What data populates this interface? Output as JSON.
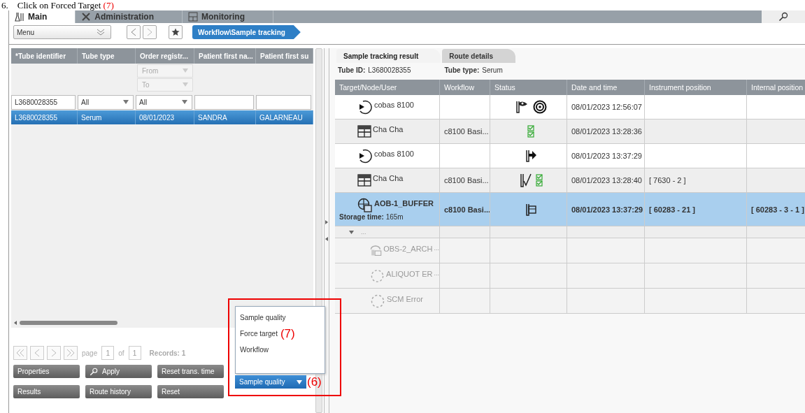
{
  "caption": {
    "number": "6.",
    "text": "Click on Forced Target",
    "marker": "(7)"
  },
  "top_tabs": [
    {
      "label": "Main",
      "selected": true
    },
    {
      "label": "Administration",
      "selected": false
    },
    {
      "label": "Monitoring",
      "selected": false
    }
  ],
  "toolbar": {
    "menu": "Menu",
    "breadcrumb": "Workflow\\Sample tracking"
  },
  "search_table": {
    "columns": [
      "*Tube identifier",
      "Tube type",
      "Order registr...",
      "Patient first na...",
      "Patient first su"
    ],
    "date_filters": {
      "from": "From",
      "to": "To"
    },
    "filters": [
      {
        "kind": "text",
        "value": "L3680028355"
      },
      {
        "kind": "select",
        "value": "All"
      },
      {
        "kind": "select",
        "value": "All"
      },
      {
        "kind": "text"
      },
      {
        "kind": "text"
      }
    ],
    "rows": [
      {
        "cells": [
          "L3680028355",
          "Serum",
          "08/01/2023",
          "SANDRA",
          "GALARNEAU"
        ],
        "selected": true
      }
    ]
  },
  "pager": {
    "page_label": "page",
    "page": "1",
    "of_label": "of",
    "total": "1",
    "records": "Records: 1"
  },
  "buttons": [
    {
      "label": "Properties",
      "kind": "plain"
    },
    {
      "label": "Apply",
      "kind": "search"
    },
    {
      "label": "Reset trans. time",
      "kind": "plain"
    },
    {
      "label": "Results",
      "kind": "plain"
    },
    {
      "label": "Route history",
      "kind": "plain"
    },
    {
      "label": "Reset",
      "kind": "plain"
    }
  ],
  "action_dropdown": {
    "value": "Sample quality",
    "expanded": true,
    "options": [
      "Sample quality",
      "Force target",
      "Workflow"
    ]
  },
  "annotations": [
    "(7)",
    "(6)"
  ],
  "result_tabs": [
    {
      "label": "Sample tracking result",
      "selected": true
    },
    {
      "label": "Route details",
      "selected": false
    }
  ],
  "tube_info": [
    {
      "label": "Tube ID:",
      "value": "L3680028355"
    },
    {
      "label": "Tube type:",
      "value": "Serum"
    }
  ],
  "route_table": {
    "columns": [
      "Target/Node/User",
      "Workflow",
      "Status",
      "Date and time",
      "Instrument position",
      "Internal position"
    ],
    "rows": [
      {
        "kind": "instrument",
        "target": "cobas 8100",
        "status": [
          {
            "kind": "tube-eye"
          },
          {
            "kind": "spiral"
          }
        ],
        "date": "08/01/2023 12:56:07",
        "selected": false,
        "disabled": false
      },
      {
        "kind": "module",
        "target": "Cha Cha",
        "workflow": "c8100 Basi...",
        "status": [
          {
            "kind": "checklist"
          }
        ],
        "date": "08/01/2023 13:28:36",
        "selected": false,
        "disabled": false
      },
      {
        "kind": "instrument",
        "target": "cobas 8100",
        "status": [
          {
            "kind": "tube-arrow"
          }
        ],
        "date": "08/01/2023 13:37:29",
        "selected": false,
        "disabled": false
      },
      {
        "kind": "module",
        "target": "Cha Cha",
        "workflow": "c8100 Basi...",
        "status": [
          {
            "kind": "tube-check"
          },
          {
            "kind": "checklist"
          }
        ],
        "date": "08/01/2023 13:28:40",
        "instrument_position": "[ 7630 - 2 ]",
        "selected": false,
        "disabled": false
      },
      {
        "kind": "storage",
        "target": "AOB-1_BUFFER",
        "storage_label": "Storage time:",
        "storage_value": "165m",
        "workflow": "c8100 Basi...",
        "status": [
          {
            "kind": "tube-box"
          }
        ],
        "date": "08/01/2023 13:37:29",
        "instrument_position": "[ 60283 - 21 ]",
        "internal_position": "[ 60283 - 3 - 1 ]",
        "selected": true,
        "disabled": false
      },
      {
        "kind": "group",
        "text": "...",
        "expanded": true
      },
      {
        "kind": "archive",
        "target": "OBS-2_ARCH",
        "more": "...",
        "selected": false,
        "disabled": true
      },
      {
        "kind": "error",
        "target": "ALIQUOT ER",
        "more": "...",
        "selected": false,
        "disabled": true
      },
      {
        "kind": "error",
        "target": "SCM Error",
        "selected": false,
        "disabled": true
      }
    ]
  }
}
